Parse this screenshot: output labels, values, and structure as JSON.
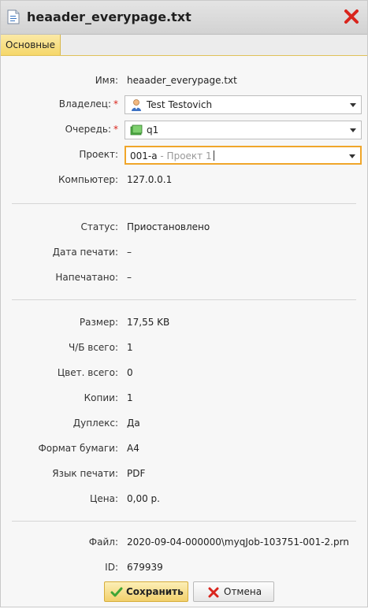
{
  "window": {
    "title": "heaader_everypage.txt",
    "icon": "text-file-icon",
    "close_icon": "close-x-icon"
  },
  "tabs": [
    {
      "label": "Основные",
      "active": true
    }
  ],
  "general": {
    "name_label": "Имя:",
    "name_value": "heaader_everypage.txt",
    "owner_label": "Владелец:",
    "owner_value": "Test Testovich",
    "owner_icon": "user-icon",
    "queue_label": "Очередь:",
    "queue_value": "q1",
    "queue_icon": "printer-queue-icon",
    "project_label": "Проект:",
    "project_code": "001-a",
    "project_name": " - Проект 1",
    "computer_label": "Компьютер:",
    "computer_value": "127.0.0.1",
    "required_mark": "*"
  },
  "status_section": {
    "status_label": "Статус:",
    "status_value": "Приостановлено",
    "print_date_label": "Дата печати:",
    "print_date_value": "–",
    "printed_label": "Напечатано:",
    "printed_value": "–"
  },
  "details": {
    "size_label": "Размер:",
    "size_value": "17,55 KB",
    "bw_total_label": "Ч/Б всего:",
    "bw_total_value": "1",
    "color_total_label": "Цвет. всего:",
    "color_total_value": "0",
    "copies_label": "Копии:",
    "copies_value": "1",
    "duplex_label": "Дуплекс:",
    "duplex_value": "Да",
    "paper_format_label": "Формат бумаги:",
    "paper_format_value": "A4",
    "print_language_label": "Язык печати:",
    "print_language_value": "PDF",
    "price_label": "Цена:",
    "price_value": "0,00 р."
  },
  "file_section": {
    "file_label": "Файл:",
    "file_value": "2020-09-04-000000\\myqJob-103751-001-2.prn",
    "id_label": "ID:",
    "id_value": "679939"
  },
  "buttons": {
    "save_label": "Сохранить",
    "cancel_label": "Отмена"
  },
  "colors": {
    "accent_tab": "#f5d769",
    "focus_border": "#f0a62a",
    "required": "#d9241c",
    "close_red": "#d9241c",
    "save_check": "#3fa535"
  }
}
